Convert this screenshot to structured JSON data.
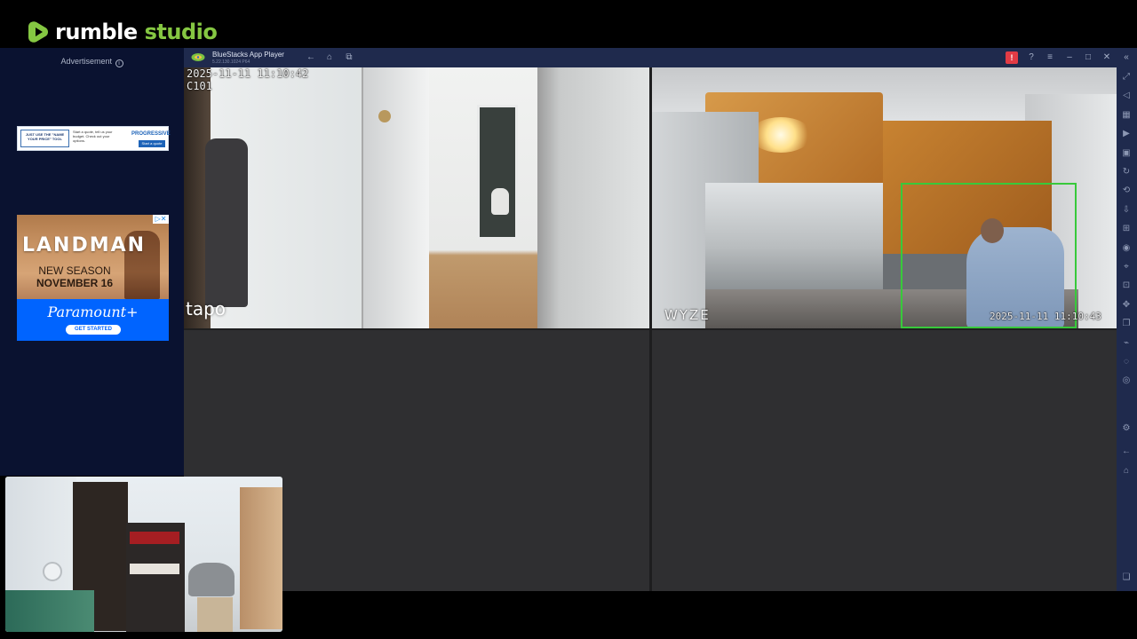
{
  "brand": {
    "word1": "rumble",
    "word2": "studio",
    "accent_color": "#85c742"
  },
  "ad_sidebar": {
    "label": "Advertisement",
    "banner1": {
      "tagline": "JUST USE THE \"NAME YOUR PRICE\" TOOL",
      "body": "Start a quote, tell us your budget. Check out your options.",
      "brand": "PROGRESSIVE",
      "button": "Start a quote"
    },
    "banner2": {
      "title": "LANDMAN",
      "line1": "NEW SEASON",
      "line2": "NOVEMBER 16",
      "adchoices": "▷✕",
      "brand": "Paramount+",
      "button": "GET STARTED"
    }
  },
  "bluestacks": {
    "title": "BlueStacks App Player",
    "subtitle": "5.22.130.1024 P64",
    "titlebar_icons": [
      "back-icon",
      "home-icon",
      "copy-icon",
      "notification-icon",
      "help-icon",
      "menu-icon",
      "minimize-icon",
      "maximize-icon",
      "close-icon",
      "collapse-icon"
    ],
    "sidebar_icons": [
      "fullscreen-icon",
      "volume-icon",
      "keyboard-icon",
      "media-icon",
      "screenshot-icon",
      "rotate-icon",
      "sync-icon",
      "install-apk-icon",
      "gamepad-icon",
      "camera-icon",
      "location-icon",
      "shake-icon",
      "instance-icon",
      "eco-mode-icon",
      "macro-icon",
      "layers-icon",
      "refresh-icon",
      "settings-icon",
      "back-nav-icon",
      "home-nav-icon",
      "recents-icon"
    ],
    "cameras": [
      {
        "timestamp": "2025-11-11  11:10:42",
        "channel": "C101",
        "brand": "tapo"
      },
      {
        "timestamp": "2025-11-11  11:10:43",
        "brand": "WYZE",
        "detection_color": "#38c93b"
      }
    ]
  }
}
